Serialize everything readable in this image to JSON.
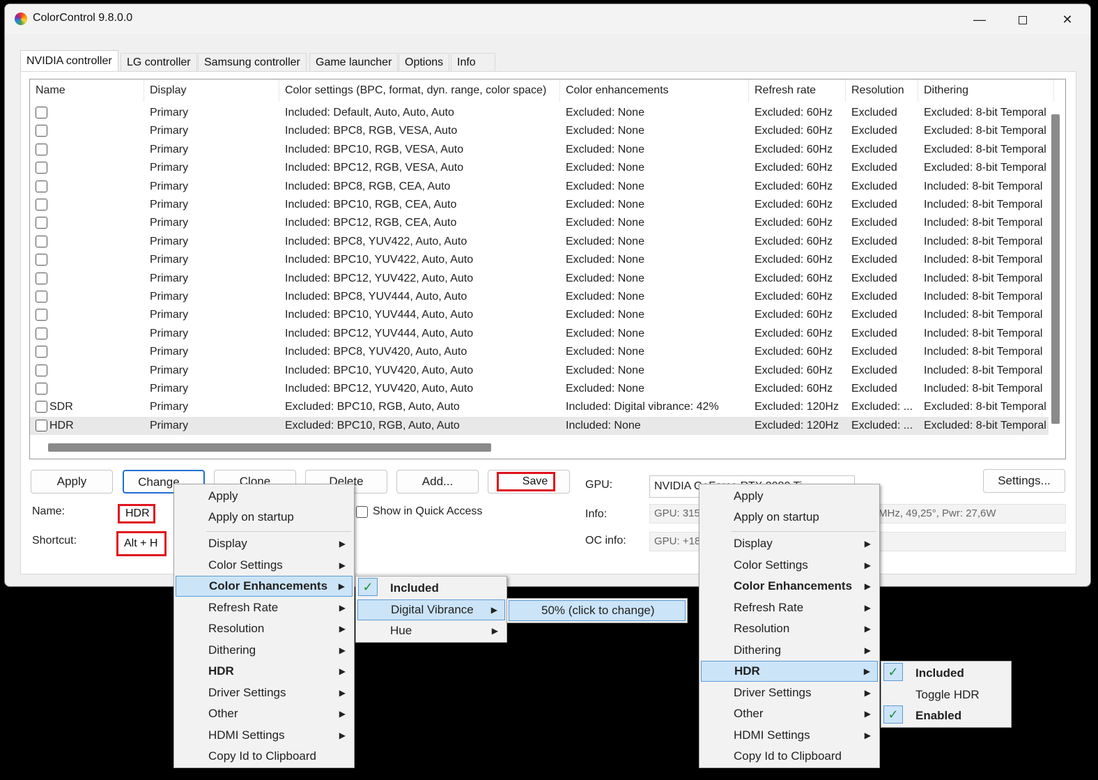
{
  "window": {
    "title": "ColorControl 9.8.0.0"
  },
  "tabs": [
    "NVIDIA controller",
    "LG controller",
    "Samsung controller",
    "Game launcher",
    "Options",
    "Info"
  ],
  "grid": {
    "columns": [
      "Name",
      "Display",
      "Color settings (BPC, format, dyn. range, color space)",
      "Color enhancements",
      "Refresh rate",
      "Resolution",
      "Dithering"
    ],
    "rows": [
      {
        "name": "",
        "display": "Primary",
        "color": "Included: Default, Auto, Auto, Auto",
        "enh": "Excluded: None",
        "refresh": "Excluded: 60Hz",
        "res": "Excluded",
        "dither": "Excluded: 8-bit Temporal"
      },
      {
        "name": "",
        "display": "Primary",
        "color": "Included: BPC8, RGB, VESA, Auto",
        "enh": "Excluded: None",
        "refresh": "Excluded: 60Hz",
        "res": "Excluded",
        "dither": "Excluded: 8-bit Temporal"
      },
      {
        "name": "",
        "display": "Primary",
        "color": "Included: BPC10, RGB, VESA, Auto",
        "enh": "Excluded: None",
        "refresh": "Excluded: 60Hz",
        "res": "Excluded",
        "dither": "Excluded: 8-bit Temporal"
      },
      {
        "name": "",
        "display": "Primary",
        "color": "Included: BPC12, RGB, VESA, Auto",
        "enh": "Excluded: None",
        "refresh": "Excluded: 60Hz",
        "res": "Excluded",
        "dither": "Excluded: 8-bit Temporal"
      },
      {
        "name": "",
        "display": "Primary",
        "color": "Included: BPC8, RGB, CEA, Auto",
        "enh": "Excluded: None",
        "refresh": "Excluded: 60Hz",
        "res": "Excluded",
        "dither": "Included: 8-bit Temporal"
      },
      {
        "name": "",
        "display": "Primary",
        "color": "Included: BPC10, RGB, CEA, Auto",
        "enh": "Excluded: None",
        "refresh": "Excluded: 60Hz",
        "res": "Excluded",
        "dither": "Included: 8-bit Temporal"
      },
      {
        "name": "",
        "display": "Primary",
        "color": "Included: BPC12, RGB, CEA, Auto",
        "enh": "Excluded: None",
        "refresh": "Excluded: 60Hz",
        "res": "Excluded",
        "dither": "Included: 8-bit Temporal"
      },
      {
        "name": "",
        "display": "Primary",
        "color": "Included: BPC8, YUV422, Auto, Auto",
        "enh": "Excluded: None",
        "refresh": "Excluded: 60Hz",
        "res": "Excluded",
        "dither": "Included: 8-bit Temporal"
      },
      {
        "name": "",
        "display": "Primary",
        "color": "Included: BPC10, YUV422, Auto, Auto",
        "enh": "Excluded: None",
        "refresh": "Excluded: 60Hz",
        "res": "Excluded",
        "dither": "Included: 8-bit Temporal"
      },
      {
        "name": "",
        "display": "Primary",
        "color": "Included: BPC12, YUV422, Auto, Auto",
        "enh": "Excluded: None",
        "refresh": "Excluded: 60Hz",
        "res": "Excluded",
        "dither": "Included: 8-bit Temporal"
      },
      {
        "name": "",
        "display": "Primary",
        "color": "Included: BPC8, YUV444, Auto, Auto",
        "enh": "Excluded: None",
        "refresh": "Excluded: 60Hz",
        "res": "Excluded",
        "dither": "Included: 8-bit Temporal"
      },
      {
        "name": "",
        "display": "Primary",
        "color": "Included: BPC10, YUV444, Auto, Auto",
        "enh": "Excluded: None",
        "refresh": "Excluded: 60Hz",
        "res": "Excluded",
        "dither": "Included: 8-bit Temporal"
      },
      {
        "name": "",
        "display": "Primary",
        "color": "Included: BPC12, YUV444, Auto, Auto",
        "enh": "Excluded: None",
        "refresh": "Excluded: 60Hz",
        "res": "Excluded",
        "dither": "Included: 8-bit Temporal"
      },
      {
        "name": "",
        "display": "Primary",
        "color": "Included: BPC8, YUV420, Auto, Auto",
        "enh": "Excluded: None",
        "refresh": "Excluded: 60Hz",
        "res": "Excluded",
        "dither": "Included: 8-bit Temporal"
      },
      {
        "name": "",
        "display": "Primary",
        "color": "Included: BPC10, YUV420, Auto, Auto",
        "enh": "Excluded: None",
        "refresh": "Excluded: 60Hz",
        "res": "Excluded",
        "dither": "Included: 8-bit Temporal"
      },
      {
        "name": "",
        "display": "Primary",
        "color": "Included: BPC12, YUV420, Auto, Auto",
        "enh": "Excluded: None",
        "refresh": "Excluded: 60Hz",
        "res": "Excluded",
        "dither": "Included: 8-bit Temporal"
      },
      {
        "name": "SDR",
        "display": "Primary",
        "color": "Excluded: BPC10, RGB, Auto, Auto",
        "enh": "Included: Digital vibrance: 42%",
        "refresh": "Excluded: 120Hz",
        "res": "Excluded: ...",
        "dither": "Excluded: 8-bit Temporal"
      },
      {
        "name": "HDR",
        "display": "Primary",
        "color": "Excluded: BPC10, RGB, Auto, Auto",
        "enh": "Included: None",
        "refresh": "Excluded: 120Hz",
        "res": "Excluded: ...",
        "dither": "Excluded: 8-bit Temporal"
      }
    ]
  },
  "buttons": {
    "apply": "Apply",
    "change": "Change...",
    "clone": "Clone",
    "delete": "Delete",
    "add": "Add...",
    "save": "Save",
    "settings": "Settings..."
  },
  "form": {
    "name_label": "Name:",
    "name_value": "HDR",
    "shortcut_label": "Shortcut:",
    "shortcut_value": "Alt + H",
    "quick_access_label": "Show in Quick Access",
    "gpu_label": "GPU:",
    "gpu_value": "NVIDIA GeForce RTX 2080 Ti",
    "info_label": "Info:",
    "info_value_left": "GPU: 315M",
    "info_value_right": "MHz, 49,25°, Pwr: 27,6W",
    "oc_label": "OC info:",
    "oc_value_left": "GPU: +18"
  },
  "context_menu": {
    "items": [
      "Apply",
      "Apply on startup",
      "Display",
      "Color Settings",
      "Color Enhancements",
      "Refresh Rate",
      "Resolution",
      "Dithering",
      "HDR",
      "Driver Settings",
      "Other",
      "HDMI Settings",
      "Copy Id to Clipboard"
    ]
  },
  "enh_submenu": {
    "included": "Included",
    "digital_vibrance": "Digital Vibrance",
    "hue": "Hue"
  },
  "vibrance_submenu": {
    "value": "50% (click to change)"
  },
  "hdr_submenu": {
    "included": "Included",
    "toggle": "Toggle HDR",
    "enabled": "Enabled"
  },
  "colors": {
    "highlight": "#cce4f7",
    "highlight_border": "#5b9bd5",
    "annotation_red": "#e0141c",
    "check_green": "#1e8c3a"
  }
}
